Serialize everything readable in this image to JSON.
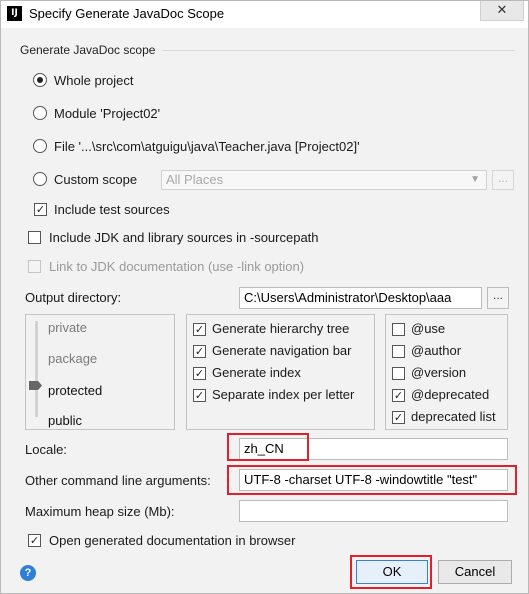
{
  "window": {
    "title": "Specify Generate JavaDoc Scope",
    "app_icon_text": "IJ",
    "close_glyph": "✕"
  },
  "scope_group": {
    "title": "Generate JavaDoc scope",
    "options": [
      {
        "label": "Whole project",
        "selected": true
      },
      {
        "label": "Module 'Project02'",
        "selected": false
      },
      {
        "label": "File '...\\src\\com\\atguigu\\java\\Teacher.java [Project02]'",
        "selected": false
      },
      {
        "label": "Custom scope",
        "selected": false
      }
    ],
    "custom_scope_combo_value": "All Places",
    "custom_scope_browse": "...",
    "include_test_sources": {
      "label": "Include test sources",
      "checked": true
    }
  },
  "include_jdk": {
    "label": "Include JDK and library sources in -sourcepath",
    "checked": false
  },
  "link_jdk": {
    "label": "Link to JDK documentation (use -link option)",
    "checked": false,
    "enabled": false
  },
  "output_directory": {
    "label": "Output directory:",
    "value": "C:\\Users\\Administrator\\Desktop\\aaa",
    "browse": "..."
  },
  "visibility_levels": [
    "private",
    "package",
    "protected",
    "public"
  ],
  "selected_visibility": "protected",
  "generate_options": [
    {
      "label": "Generate hierarchy tree",
      "checked": true
    },
    {
      "label": "Generate navigation bar",
      "checked": true
    },
    {
      "label": "Generate index",
      "checked": true
    },
    {
      "label": "Separate index per letter",
      "checked": true
    }
  ],
  "tag_options": [
    {
      "label": "@use",
      "checked": false
    },
    {
      "label": "@author",
      "checked": false
    },
    {
      "label": "@version",
      "checked": false
    },
    {
      "label": "@deprecated",
      "checked": true
    },
    {
      "label": "deprecated list",
      "checked": true
    }
  ],
  "locale": {
    "label": "Locale:",
    "value": "zh_CN"
  },
  "other_args": {
    "label": "Other command line arguments:",
    "value": "UTF-8 -charset UTF-8 -windowtitle \"test\""
  },
  "heap_size": {
    "label": "Maximum heap size (Mb):",
    "value": ""
  },
  "open_in_browser": {
    "label": "Open generated documentation in browser",
    "checked": true
  },
  "buttons": {
    "help_glyph": "?",
    "ok": "OK",
    "cancel": "Cancel"
  },
  "colors": {
    "highlight_red": "#e0202a",
    "primary_blue": "#3b7ed6",
    "help_blue": "#2f7fd6"
  }
}
